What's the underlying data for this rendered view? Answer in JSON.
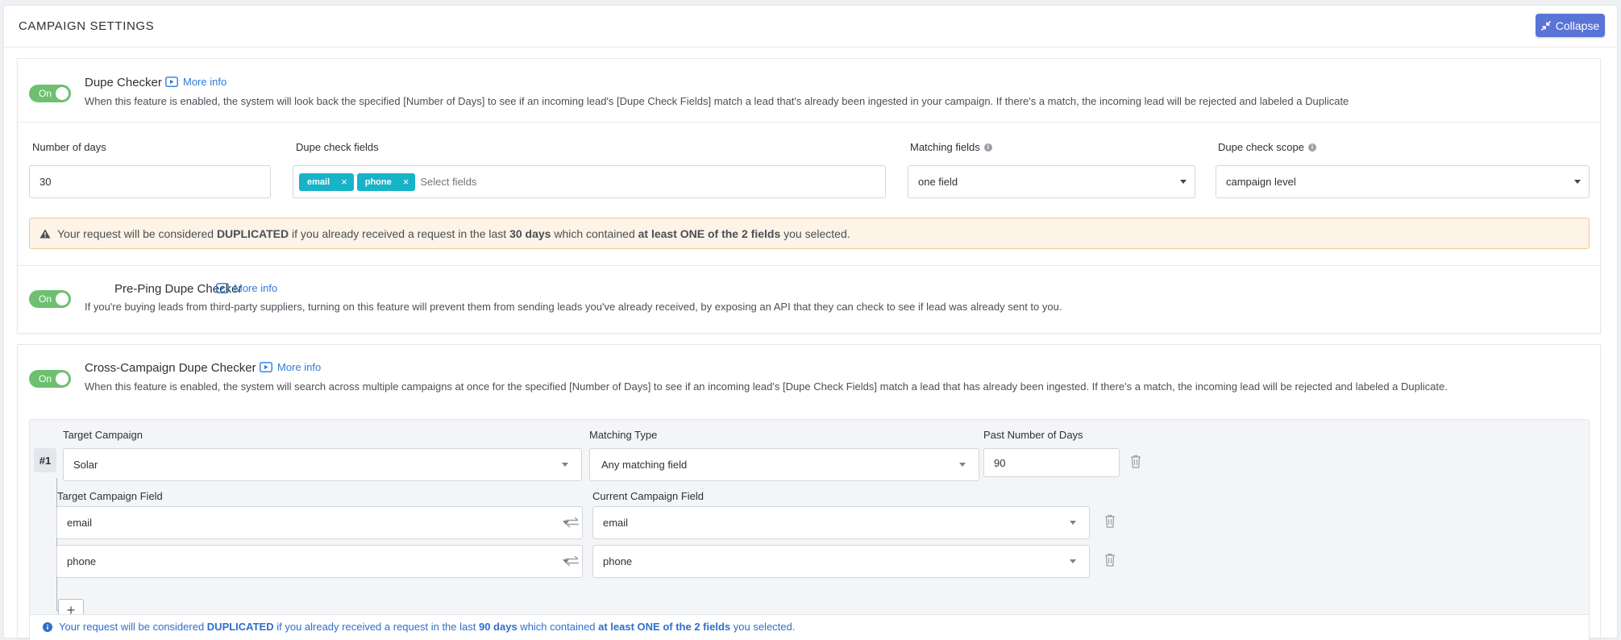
{
  "header": {
    "title": "CAMPAIGN SETTINGS",
    "collapse_label": "Collapse"
  },
  "dupe_checker": {
    "toggle_label": "On",
    "title": "Dupe Checker",
    "more_info": "More info",
    "description": "When this feature is enabled, the system will look back the specified [Number of Days] to see if an incoming lead's [Dupe Check Fields] match a lead that's already been ingested in your campaign. If there's a match, the incoming lead will be rejected and labeled a Duplicate",
    "number_of_days_label": "Number of days",
    "number_of_days_value": "30",
    "dupe_fields_label": "Dupe check fields",
    "dupe_fields_tags": [
      "email",
      "phone"
    ],
    "dupe_fields_placeholder": "Select fields",
    "matching_fields_label": "Matching fields",
    "matching_fields_value": "one field",
    "scope_label": "Dupe check scope",
    "scope_value": "campaign level",
    "warning": {
      "part1": "Your request will be considered ",
      "bold1": "DUPLICATED",
      "part2": " if you already received a request in the last ",
      "bold2": "30 days",
      "part3": " which contained ",
      "bold3": "at least ONE of the 2 fields",
      "part4": " you selected."
    }
  },
  "pre_ping": {
    "toggle_label": "On",
    "title": "Pre-Ping Dupe Checker",
    "more_info": "More info",
    "description": "If you're buying leads from third-party suppliers, turning on this feature will prevent them from sending leads you've already received, by exposing an API that they can check to see if lead was already sent to you."
  },
  "cross_campaign": {
    "toggle_label": "On",
    "title": "Cross-Campaign Dupe Checker",
    "more_info": "More info",
    "description": "When this feature is enabled, the system will search across multiple campaigns at once for the specified [Number of Days] to see if an incoming lead's [Dupe Check Fields] match a lead that has already been ingested. If there's a match, the incoming lead will be rejected and labeled a Duplicate.",
    "rule_badge": "#1",
    "target_campaign_label": "Target Campaign",
    "target_campaign_value": "Solar",
    "matching_type_label": "Matching Type",
    "matching_type_value": "Any matching field",
    "past_days_label": "Past Number of Days",
    "past_days_value": "90",
    "target_field_label": "Target Campaign Field",
    "current_field_label": "Current Campaign Field",
    "mappings": [
      {
        "target": "email",
        "current": "email"
      },
      {
        "target": "phone",
        "current": "phone"
      }
    ],
    "add_label": "+",
    "info": {
      "part1": "Your request will be considered ",
      "bold1": "DUPLICATED",
      "part2": " if you already received a request in the last ",
      "bold2": "90 days",
      "part3": " which contained ",
      "bold3": "at least ONE of the 2 fields",
      "part4": " you selected."
    }
  },
  "colors": {
    "primary": "#5a73d6",
    "toggle_on": "#6cc070",
    "tag": "#17b3c8",
    "link": "#2f7bd9",
    "warning_bg": "#fdf3e7",
    "info_text": "#2f6fc9"
  }
}
